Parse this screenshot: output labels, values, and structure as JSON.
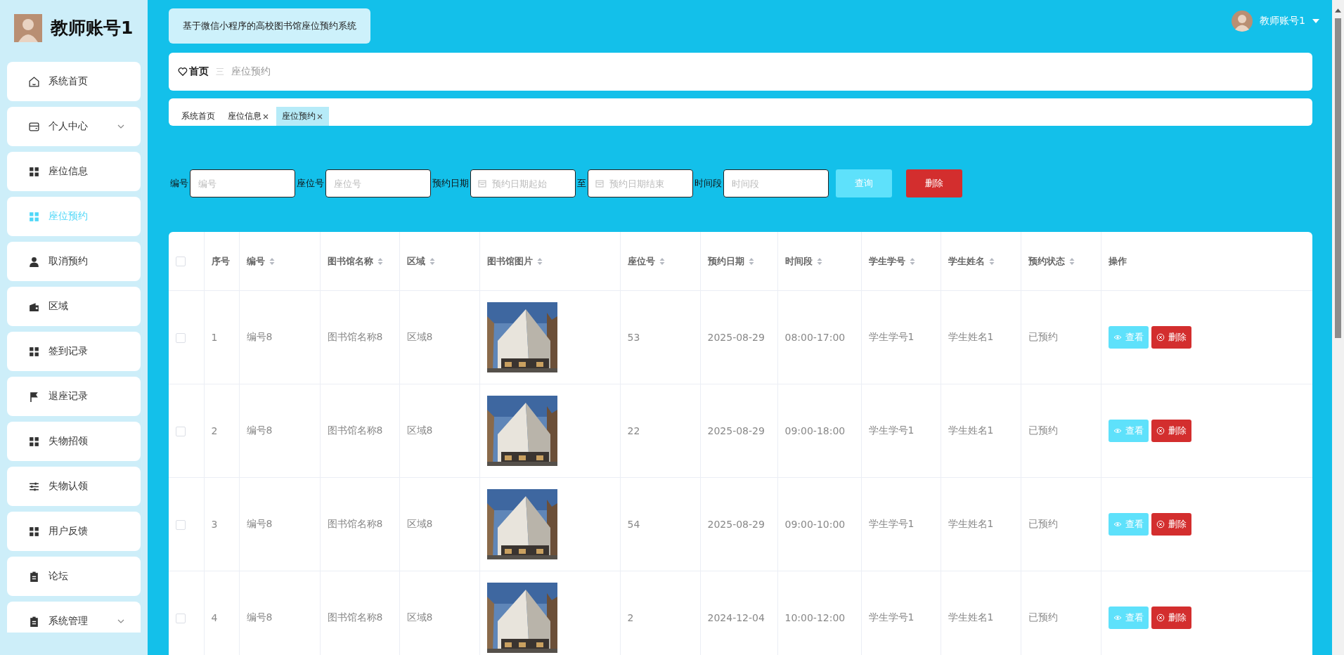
{
  "sidebar": {
    "title": "教师账号1",
    "items": [
      {
        "label": "系统首页",
        "selected": false,
        "expandable": false
      },
      {
        "label": "个人中心",
        "selected": false,
        "expandable": true
      },
      {
        "label": "座位信息",
        "selected": false,
        "expandable": false
      },
      {
        "label": "座位预约",
        "selected": true,
        "expandable": false
      },
      {
        "label": "取消预约",
        "selected": false,
        "expandable": false
      },
      {
        "label": "区域",
        "selected": false,
        "expandable": false
      },
      {
        "label": "签到记录",
        "selected": false,
        "expandable": false
      },
      {
        "label": "退座记录",
        "selected": false,
        "expandable": false
      },
      {
        "label": "失物招领",
        "selected": false,
        "expandable": false
      },
      {
        "label": "失物认领",
        "selected": false,
        "expandable": false
      },
      {
        "label": "用户反馈",
        "selected": false,
        "expandable": false
      },
      {
        "label": "论坛",
        "selected": false,
        "expandable": false
      },
      {
        "label": "系统管理",
        "selected": false,
        "expandable": true
      }
    ]
  },
  "header": {
    "system_title": "基于微信小程序的高校图书馆座位预约系统",
    "user": "教师账号1"
  },
  "breadcrumb": {
    "home": "首页",
    "separator": "三",
    "current": "座位预约"
  },
  "tabs": [
    {
      "label": "系统首页",
      "selected": false,
      "closable": false
    },
    {
      "label": "座位信息",
      "selected": false,
      "closable": true
    },
    {
      "label": "座位预约",
      "selected": true,
      "closable": true
    }
  ],
  "search": {
    "fields": [
      {
        "label": "编号",
        "placeholder": "编号",
        "kind": "text"
      },
      {
        "label": "座位号",
        "placeholder": "座位号",
        "kind": "text"
      },
      {
        "label": "预约日期",
        "placeholder": "预约日期起始",
        "kind": "date"
      },
      {
        "label": "至",
        "placeholder": "预约日期结束",
        "kind": "date"
      },
      {
        "label": "时间段",
        "placeholder": "时间段",
        "kind": "text"
      }
    ],
    "query_button": "查询",
    "delete_button": "删除"
  },
  "table": {
    "columns": [
      {
        "label": "序号",
        "sortable": false
      },
      {
        "label": "编号",
        "sortable": true
      },
      {
        "label": "图书馆名称",
        "sortable": true
      },
      {
        "label": "区域",
        "sortable": true
      },
      {
        "label": "图书馆图片",
        "sortable": true
      },
      {
        "label": "座位号",
        "sortable": true
      },
      {
        "label": "预约日期",
        "sortable": true
      },
      {
        "label": "时间段",
        "sortable": true
      },
      {
        "label": "学生学号",
        "sortable": true
      },
      {
        "label": "学生姓名",
        "sortable": true
      },
      {
        "label": "预约状态",
        "sortable": true
      },
      {
        "label": "操作",
        "sortable": false
      }
    ],
    "select_all": {
      "checked": false
    },
    "rows": [
      {
        "checked": false,
        "index": "1",
        "code": "编号8",
        "library": "图书馆名称8",
        "area": "区域8",
        "seat": "53",
        "date": "2025-08-29",
        "period": "08:00-17:00",
        "student_no": "学生学号1",
        "student_name": "学生姓名1",
        "status": "已预约",
        "view": "查看",
        "delete": "删除"
      },
      {
        "checked": false,
        "index": "2",
        "code": "编号8",
        "library": "图书馆名称8",
        "area": "区域8",
        "seat": "22",
        "date": "2025-08-29",
        "period": "09:00-18:00",
        "student_no": "学生学号1",
        "student_name": "学生姓名1",
        "status": "已预约",
        "view": "查看",
        "delete": "删除"
      },
      {
        "checked": false,
        "index": "3",
        "code": "编号8",
        "library": "图书馆名称8",
        "area": "区域8",
        "seat": "54",
        "date": "2025-08-29",
        "period": "09:00-10:00",
        "student_no": "学生学号1",
        "student_name": "学生姓名1",
        "status": "已预约",
        "view": "查看",
        "delete": "删除"
      },
      {
        "checked": false,
        "index": "4",
        "code": "编号8",
        "library": "图书馆名称8",
        "area": "区域8",
        "seat": "2",
        "date": "2024-12-04",
        "period": "10:00-12:00",
        "student_no": "学生学号1",
        "student_name": "学生姓名1",
        "status": "已预约",
        "view": "查看",
        "delete": "删除"
      }
    ]
  }
}
